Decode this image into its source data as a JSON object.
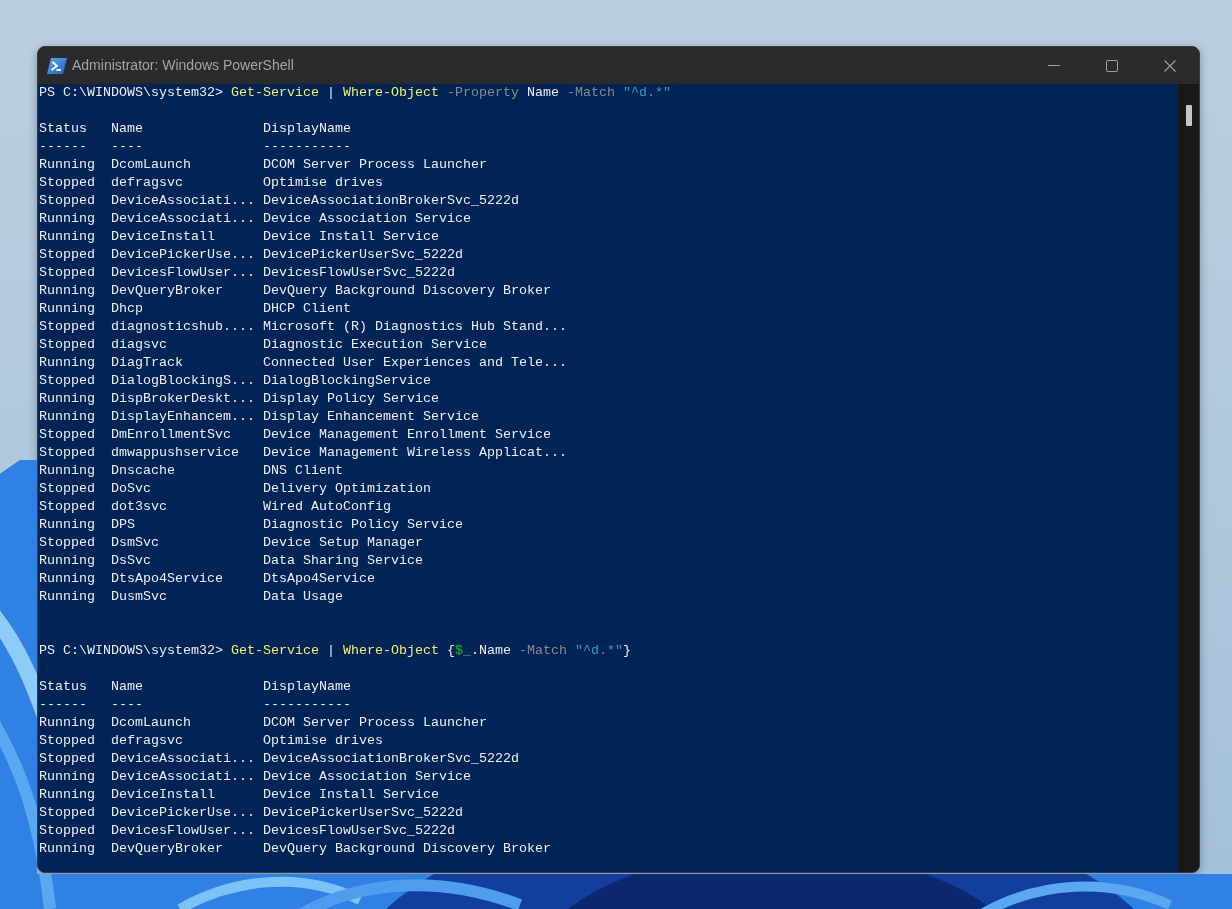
{
  "window": {
    "title": "Administrator: Windows PowerShell"
  },
  "console": {
    "sessions": [
      {
        "prompt": "PS C:\\WINDOWS\\system32>",
        "command": [
          {
            "segments": [
              {
                "text": "Get-Service",
                "kind": "command"
              }
            ]
          },
          {
            "segments": [
              {
                "text": "|",
                "kind": "operator"
              }
            ]
          },
          {
            "segments": [
              {
                "text": "Where-Object",
                "kind": "command"
              }
            ]
          },
          {
            "segments": [
              {
                "text": "-Property",
                "kind": "parameter"
              }
            ]
          },
          {
            "segments": [
              {
                "text": "Name",
                "kind": "argument"
              }
            ]
          },
          {
            "segments": [
              {
                "text": "-Match",
                "kind": "parameter"
              }
            ]
          },
          {
            "segments": [
              {
                "text": "\"^d.*\"",
                "kind": "string"
              }
            ]
          }
        ],
        "table": {
          "columns": [
            {
              "heading": "Status",
              "underline": "------"
            },
            {
              "heading": "Name",
              "underline": "----"
            },
            {
              "heading": "DisplayName",
              "underline": "-----------"
            }
          ],
          "rows": [
            {
              "status": "Running",
              "name": "DcomLaunch",
              "display_name": "DCOM Server Process Launcher"
            },
            {
              "status": "Stopped",
              "name": "defragsvc",
              "display_name": "Optimise drives"
            },
            {
              "status": "Stopped",
              "name": "DeviceAssociati...",
              "display_name": "DeviceAssociationBrokerSvc_5222d"
            },
            {
              "status": "Running",
              "name": "DeviceAssociati...",
              "display_name": "Device Association Service"
            },
            {
              "status": "Running",
              "name": "DeviceInstall",
              "display_name": "Device Install Service"
            },
            {
              "status": "Stopped",
              "name": "DevicePickerUse...",
              "display_name": "DevicePickerUserSvc_5222d"
            },
            {
              "status": "Stopped",
              "name": "DevicesFlowUser...",
              "display_name": "DevicesFlowUserSvc_5222d"
            },
            {
              "status": "Running",
              "name": "DevQueryBroker",
              "display_name": "DevQuery Background Discovery Broker"
            },
            {
              "status": "Running",
              "name": "Dhcp",
              "display_name": "DHCP Client"
            },
            {
              "status": "Stopped",
              "name": "diagnosticshub....",
              "display_name": "Microsoft (R) Diagnostics Hub Stand..."
            },
            {
              "status": "Stopped",
              "name": "diagsvc",
              "display_name": "Diagnostic Execution Service"
            },
            {
              "status": "Running",
              "name": "DiagTrack",
              "display_name": "Connected User Experiences and Tele..."
            },
            {
              "status": "Stopped",
              "name": "DialogBlockingS...",
              "display_name": "DialogBlockingService"
            },
            {
              "status": "Running",
              "name": "DispBrokerDeskt...",
              "display_name": "Display Policy Service"
            },
            {
              "status": "Running",
              "name": "DisplayEnhancem...",
              "display_name": "Display Enhancement Service"
            },
            {
              "status": "Stopped",
              "name": "DmEnrollmentSvc",
              "display_name": "Device Management Enrollment Service"
            },
            {
              "status": "Stopped",
              "name": "dmwappushservice",
              "display_name": "Device Management Wireless Applicat..."
            },
            {
              "status": "Running",
              "name": "Dnscache",
              "display_name": "DNS Client"
            },
            {
              "status": "Stopped",
              "name": "DoSvc",
              "display_name": "Delivery Optimization"
            },
            {
              "status": "Stopped",
              "name": "dot3svc",
              "display_name": "Wired AutoConfig"
            },
            {
              "status": "Running",
              "name": "DPS",
              "display_name": "Diagnostic Policy Service"
            },
            {
              "status": "Stopped",
              "name": "DsmSvc",
              "display_name": "Device Setup Manager"
            },
            {
              "status": "Running",
              "name": "DsSvc",
              "display_name": "Data Sharing Service"
            },
            {
              "status": "Running",
              "name": "DtsApo4Service",
              "display_name": "DtsApo4Service"
            },
            {
              "status": "Running",
              "name": "DusmSvc",
              "display_name": "Data Usage"
            }
          ]
        }
      },
      {
        "prompt": "PS C:\\WINDOWS\\system32>",
        "command": [
          {
            "segments": [
              {
                "text": "Get-Service",
                "kind": "command"
              }
            ]
          },
          {
            "segments": [
              {
                "text": "|",
                "kind": "operator"
              }
            ]
          },
          {
            "segments": [
              {
                "text": "Where-Object",
                "kind": "command"
              }
            ]
          },
          {
            "segments": [
              {
                "text": "{",
                "kind": "operator"
              },
              {
                "text": "$_",
                "kind": "variable"
              },
              {
                "text": ".Name",
                "kind": "member"
              }
            ]
          },
          {
            "segments": [
              {
                "text": "-Match",
                "kind": "parameter"
              }
            ]
          },
          {
            "segments": [
              {
                "text": "\"^d.*\"",
                "kind": "string"
              },
              {
                "text": "}",
                "kind": "operator"
              }
            ]
          }
        ],
        "table": {
          "columns": [
            {
              "heading": "Status",
              "underline": "------"
            },
            {
              "heading": "Name",
              "underline": "----"
            },
            {
              "heading": "DisplayName",
              "underline": "-----------"
            }
          ],
          "rows": [
            {
              "status": "Running",
              "name": "DcomLaunch",
              "display_name": "DCOM Server Process Launcher"
            },
            {
              "status": "Stopped",
              "name": "defragsvc",
              "display_name": "Optimise drives"
            },
            {
              "status": "Stopped",
              "name": "DeviceAssociati...",
              "display_name": "DeviceAssociationBrokerSvc_5222d"
            },
            {
              "status": "Running",
              "name": "DeviceAssociati...",
              "display_name": "Device Association Service"
            },
            {
              "status": "Running",
              "name": "DeviceInstall",
              "display_name": "Device Install Service"
            },
            {
              "status": "Stopped",
              "name": "DevicePickerUse...",
              "display_name": "DevicePickerUserSvc_5222d"
            },
            {
              "status": "Stopped",
              "name": "DevicesFlowUser...",
              "display_name": "DevicesFlowUserSvc_5222d"
            },
            {
              "status": "Running",
              "name": "DevQueryBroker",
              "display_name": "DevQuery Background Discovery Broker"
            }
          ]
        }
      }
    ]
  }
}
